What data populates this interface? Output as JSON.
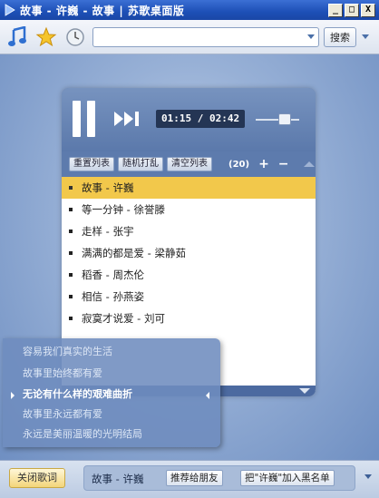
{
  "window": {
    "title": "故事 - 许巍 - 故事 | 苏歌桌面版",
    "min_label": "_",
    "max_label": "□",
    "close_label": "X"
  },
  "toolbar": {
    "search_value": "",
    "search_button": "搜索",
    "icons": [
      "music-note-icon",
      "star-icon",
      "clock-icon"
    ]
  },
  "player": {
    "current_time": "01:15",
    "separator": " / ",
    "total_time": "02:42",
    "volume_level": 0.55
  },
  "playlist": {
    "buttons": [
      "重置列表",
      "随机打乱",
      "清空列表"
    ],
    "count": "(20)",
    "add": "+",
    "remove": "−",
    "songs": [
      {
        "title": "故事 - 许巍",
        "active": true
      },
      {
        "title": "等一分钟 - 徐誉滕",
        "active": false
      },
      {
        "title": "走样 - 张宇",
        "active": false
      },
      {
        "title": "满满的都是爱 - 梁静茹",
        "active": false
      },
      {
        "title": "稻香 - 周杰伦",
        "active": false
      },
      {
        "title": "相信 - 孙燕姿",
        "active": false
      },
      {
        "title": "寂寞才说爱 - 刘可",
        "active": false
      }
    ]
  },
  "lyrics": {
    "lines": [
      "容易我们真实的生活",
      "故事里始终都有爱",
      "无论有什么样的艰难曲折",
      "故事里永远都有爱",
      "永远是美丽温暖的光明结局"
    ],
    "current_index": 2
  },
  "bottom": {
    "close_lyrics": "关闭歌词",
    "now_playing": "故事 - 许巍",
    "recommend": "推荐给朋友",
    "blacklist": "把\"许巍\"加入黑名单"
  },
  "colors": {
    "active_song": "#f2c84b",
    "titlebar": "#1d4fb6"
  }
}
